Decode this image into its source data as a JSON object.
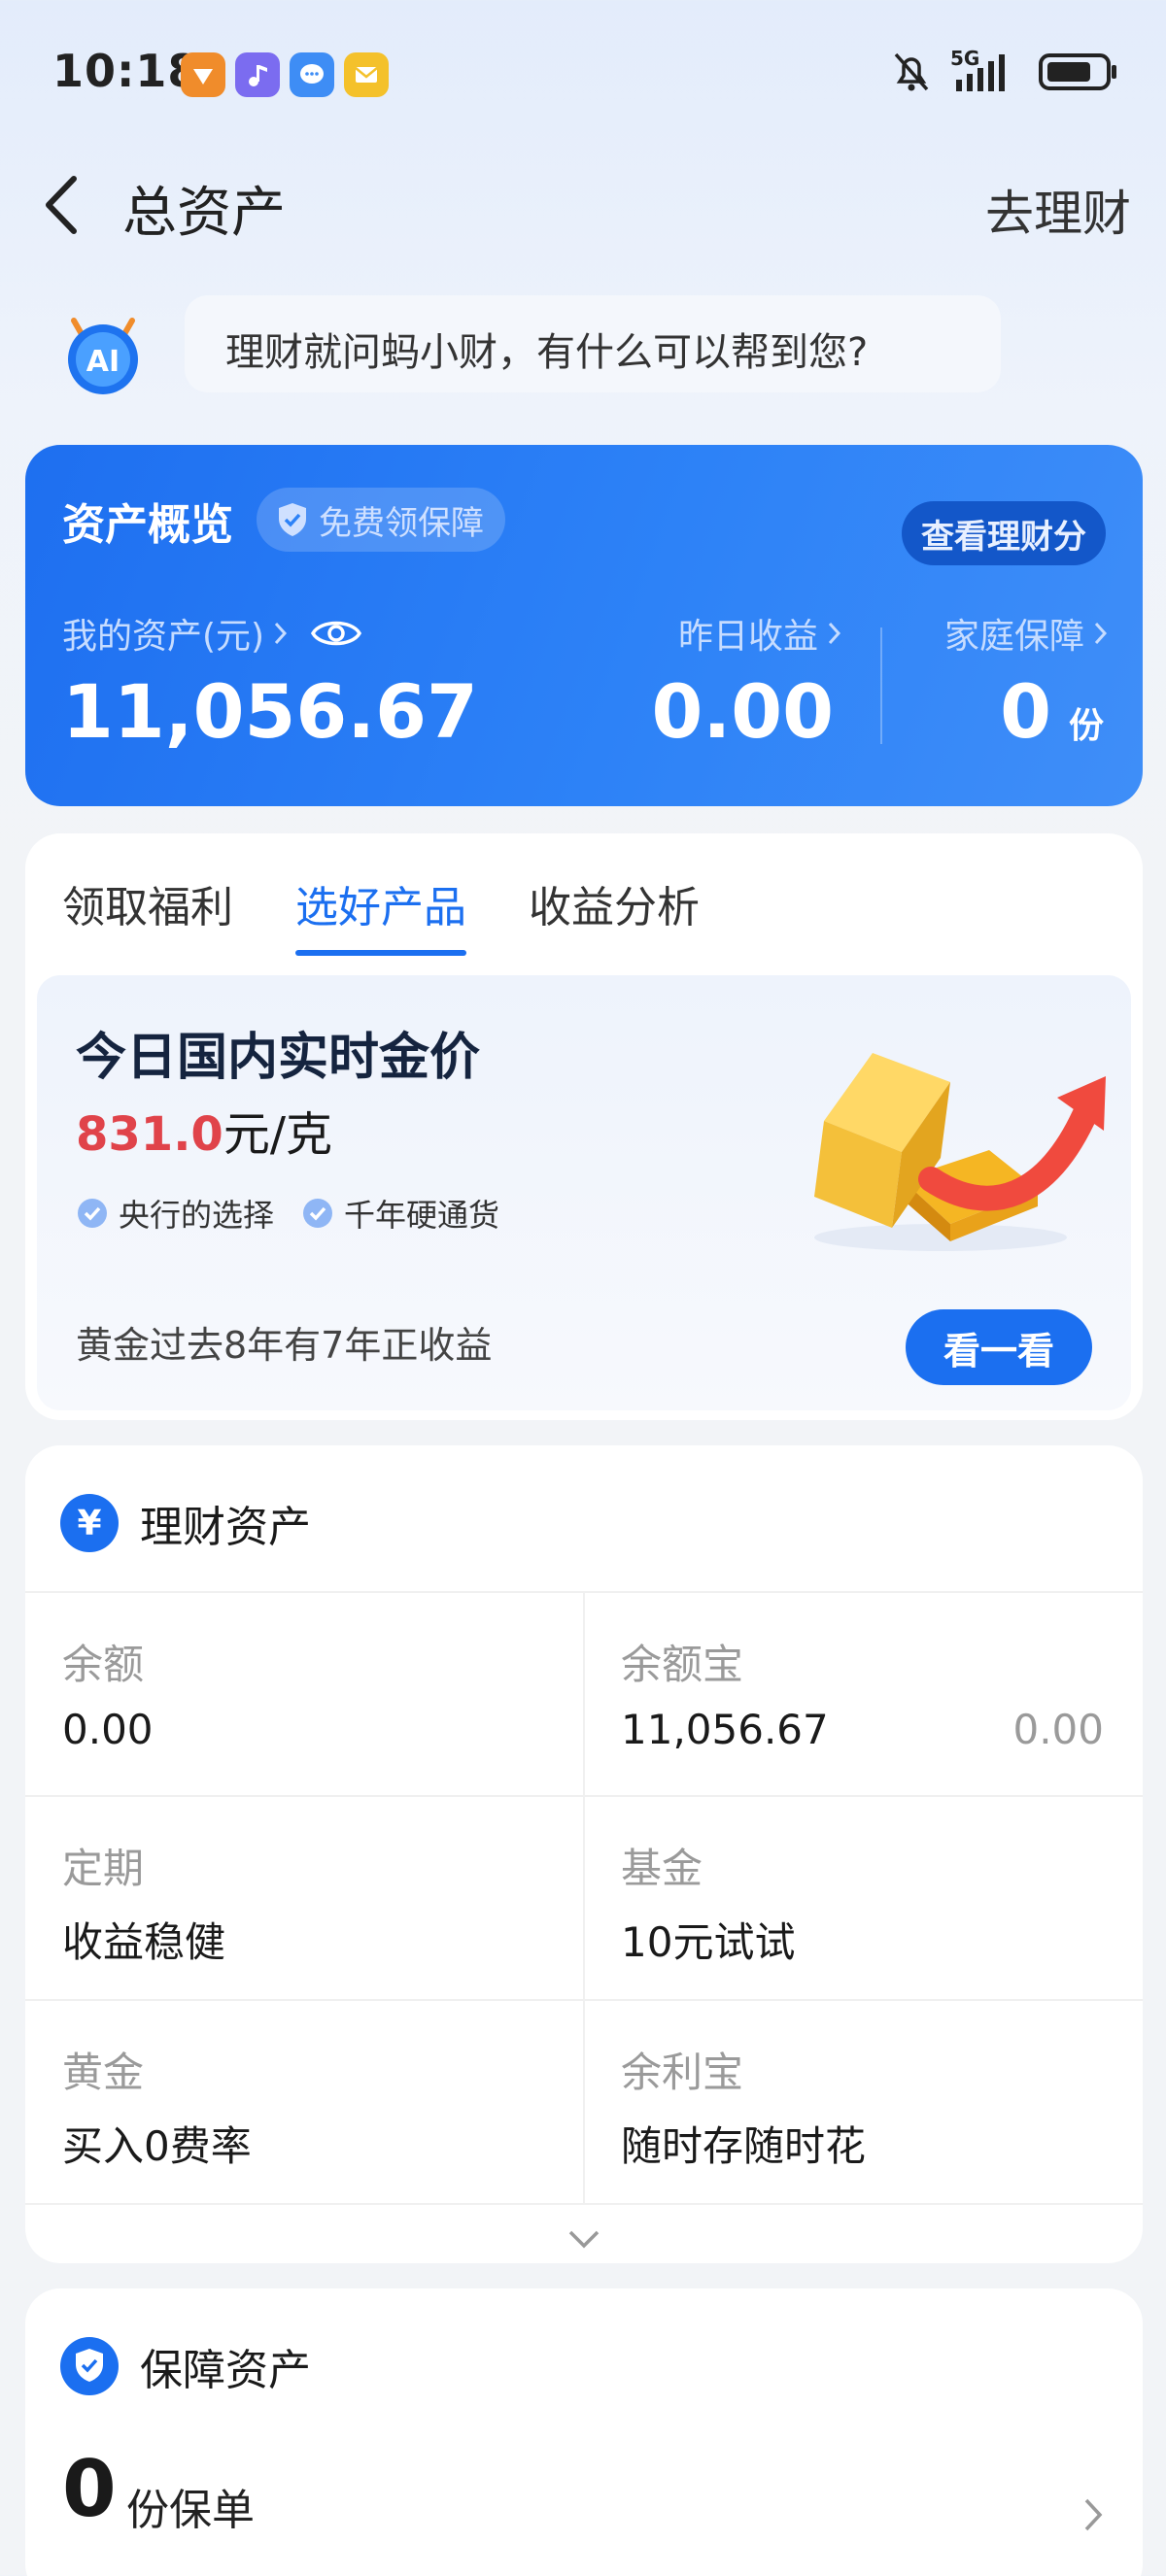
{
  "status_bar": {
    "time": "10:18",
    "network": "5G"
  },
  "nav": {
    "title": "总资产",
    "action": "去理财"
  },
  "assistant": {
    "message": "理财就问蚂小财，有什么可以帮到您?"
  },
  "overview": {
    "title": "资产概览",
    "badge": "免费领保障",
    "button": "查看理财分",
    "my_assets_label": "我的资产(元)",
    "my_assets_value": "11,056.67",
    "yesterday_label": "昨日收益",
    "yesterday_value": "0.00",
    "family_label": "家庭保障",
    "family_value": "0",
    "family_unit": "份"
  },
  "tabs": [
    {
      "label": "领取福利",
      "active": false
    },
    {
      "label": "选好产品",
      "active": true
    },
    {
      "label": "收益分析",
      "active": false
    }
  ],
  "gold": {
    "title": "今日国内实时金价",
    "price": "831.0",
    "unit": "元/克",
    "tags": [
      "央行的选择",
      "千年硬通货"
    ],
    "footer": "黄金过去8年有7年正收益",
    "button": "看一看"
  },
  "finance": {
    "title": "理财资产",
    "icon": "¥",
    "items": [
      {
        "label": "余额",
        "value": "0.00",
        "extra": ""
      },
      {
        "label": "余额宝",
        "value": "11,056.67",
        "extra": "0.00"
      },
      {
        "label": "定期",
        "value": "收益稳健",
        "extra": ""
      },
      {
        "label": "基金",
        "value": "10元试试",
        "extra": ""
      },
      {
        "label": "黄金",
        "value": "买入0费率",
        "extra": ""
      },
      {
        "label": "余利宝",
        "value": "随时存随时花",
        "extra": ""
      }
    ]
  },
  "insurance": {
    "title": "保障资产",
    "count": "0",
    "unit": "份保单"
  },
  "colors": {
    "primary": "#1b6ff0",
    "price_red": "#e0434a",
    "card_bg": "#ffffff"
  }
}
